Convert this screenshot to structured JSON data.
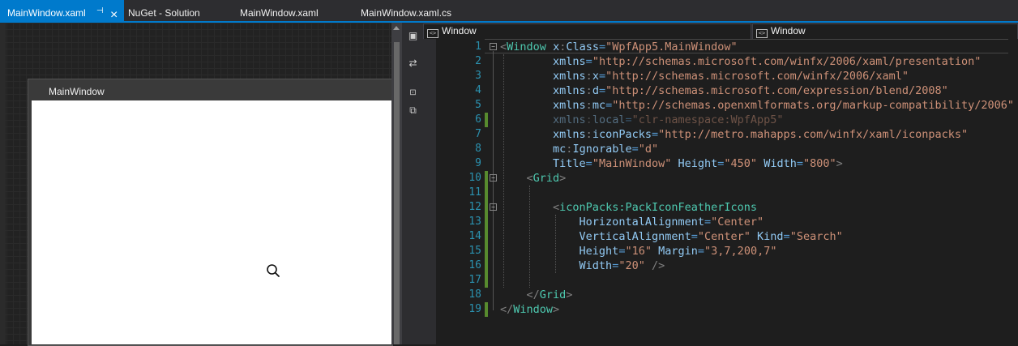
{
  "tabs": [
    {
      "label": "MainWindow.xaml",
      "active": true
    },
    {
      "label": "NuGet - Solution",
      "active": false
    },
    {
      "label": "MainWindow.xaml",
      "active": false
    },
    {
      "label": "MainWindow.xaml.cs",
      "active": false
    }
  ],
  "designer": {
    "window_title": "MainWindow",
    "icon": "search-icon"
  },
  "navbar": {
    "left": "Window",
    "right": "Window"
  },
  "editor": {
    "line_numbers": [
      "1",
      "2",
      "3",
      "4",
      "5",
      "6",
      "7",
      "8",
      "9",
      "10",
      "11",
      "12",
      "13",
      "14",
      "15",
      "16",
      "17",
      "18",
      "19"
    ],
    "lines": [
      [
        {
          "c": "t",
          "s": "<"
        },
        {
          "c": "el",
          "s": "Window"
        },
        {
          "c": "p",
          "s": " "
        },
        {
          "c": "a",
          "s": "x"
        },
        {
          "c": "t",
          "s": ":"
        },
        {
          "c": "a",
          "s": "Class"
        },
        {
          "c": "e",
          "s": "="
        },
        {
          "c": "v",
          "s": "\"WpfApp5.MainWindow\""
        }
      ],
      [
        {
          "c": "p",
          "s": "        "
        },
        {
          "c": "a",
          "s": "xmlns"
        },
        {
          "c": "e",
          "s": "="
        },
        {
          "c": "v",
          "s": "\"http://schemas.microsoft.com/winfx/2006/xaml/presentation\""
        }
      ],
      [
        {
          "c": "p",
          "s": "        "
        },
        {
          "c": "a",
          "s": "xmlns"
        },
        {
          "c": "t",
          "s": ":"
        },
        {
          "c": "a",
          "s": "x"
        },
        {
          "c": "e",
          "s": "="
        },
        {
          "c": "v",
          "s": "\"http://schemas.microsoft.com/winfx/2006/xaml\""
        }
      ],
      [
        {
          "c": "p",
          "s": "        "
        },
        {
          "c": "a",
          "s": "xmlns"
        },
        {
          "c": "t",
          "s": ":"
        },
        {
          "c": "a",
          "s": "d"
        },
        {
          "c": "e",
          "s": "="
        },
        {
          "c": "v",
          "s": "\"http://schemas.microsoft.com/expression/blend/2008\""
        }
      ],
      [
        {
          "c": "p",
          "s": "        "
        },
        {
          "c": "a",
          "s": "xmlns"
        },
        {
          "c": "t",
          "s": ":"
        },
        {
          "c": "a",
          "s": "mc"
        },
        {
          "c": "e",
          "s": "="
        },
        {
          "c": "v",
          "s": "\"http://schemas.openxmlformats.org/markup-compatibility/2006\""
        }
      ],
      [
        {
          "c": "p",
          "s": "        "
        },
        {
          "c": "a",
          "s": "xmlns"
        },
        {
          "c": "t",
          "s": ":"
        },
        {
          "c": "a",
          "s": "local"
        },
        {
          "c": "e",
          "s": "="
        },
        {
          "c": "v",
          "s": "\"clr-namespace:WpfApp5\""
        }
      ],
      [
        {
          "c": "p",
          "s": "        "
        },
        {
          "c": "a",
          "s": "xmlns"
        },
        {
          "c": "t",
          "s": ":"
        },
        {
          "c": "a",
          "s": "iconPacks"
        },
        {
          "c": "e",
          "s": "="
        },
        {
          "c": "v",
          "s": "\"http://metro.mahapps.com/winfx/xaml/iconpacks\""
        }
      ],
      [
        {
          "c": "p",
          "s": "        "
        },
        {
          "c": "a",
          "s": "mc"
        },
        {
          "c": "t",
          "s": ":"
        },
        {
          "c": "a",
          "s": "Ignorable"
        },
        {
          "c": "e",
          "s": "="
        },
        {
          "c": "v",
          "s": "\"d\""
        }
      ],
      [
        {
          "c": "p",
          "s": "        "
        },
        {
          "c": "a",
          "s": "Title"
        },
        {
          "c": "e",
          "s": "="
        },
        {
          "c": "v",
          "s": "\"MainWindow\""
        },
        {
          "c": "p",
          "s": " "
        },
        {
          "c": "a",
          "s": "Height"
        },
        {
          "c": "e",
          "s": "="
        },
        {
          "c": "v",
          "s": "\"450\""
        },
        {
          "c": "p",
          "s": " "
        },
        {
          "c": "a",
          "s": "Width"
        },
        {
          "c": "e",
          "s": "="
        },
        {
          "c": "v",
          "s": "\"800\""
        },
        {
          "c": "t",
          "s": ">"
        }
      ],
      [
        {
          "c": "p",
          "s": "    "
        },
        {
          "c": "t",
          "s": "<"
        },
        {
          "c": "el",
          "s": "Grid"
        },
        {
          "c": "t",
          "s": ">"
        }
      ],
      [
        {
          "c": "p",
          "s": ""
        }
      ],
      [
        {
          "c": "p",
          "s": "        "
        },
        {
          "c": "t",
          "s": "<"
        },
        {
          "c": "el",
          "s": "iconPacks:PackIconFeatherIcons"
        }
      ],
      [
        {
          "c": "p",
          "s": "            "
        },
        {
          "c": "a",
          "s": "HorizontalAlignment"
        },
        {
          "c": "e",
          "s": "="
        },
        {
          "c": "v",
          "s": "\"Center\""
        }
      ],
      [
        {
          "c": "p",
          "s": "            "
        },
        {
          "c": "a",
          "s": "VerticalAlignment"
        },
        {
          "c": "e",
          "s": "="
        },
        {
          "c": "v",
          "s": "\"Center\""
        },
        {
          "c": "p",
          "s": " "
        },
        {
          "c": "a",
          "s": "Kind"
        },
        {
          "c": "e",
          "s": "="
        },
        {
          "c": "v",
          "s": "\"Search\""
        }
      ],
      [
        {
          "c": "p",
          "s": "            "
        },
        {
          "c": "a",
          "s": "Height"
        },
        {
          "c": "e",
          "s": "="
        },
        {
          "c": "v",
          "s": "\"16\""
        },
        {
          "c": "p",
          "s": " "
        },
        {
          "c": "a",
          "s": "Margin"
        },
        {
          "c": "e",
          "s": "="
        },
        {
          "c": "v",
          "s": "\"3,7,200,7\""
        }
      ],
      [
        {
          "c": "p",
          "s": "            "
        },
        {
          "c": "a",
          "s": "Width"
        },
        {
          "c": "e",
          "s": "="
        },
        {
          "c": "v",
          "s": "\"20\""
        },
        {
          "c": "p",
          "s": " "
        },
        {
          "c": "t",
          "s": "/>"
        }
      ],
      [
        {
          "c": "p",
          "s": ""
        }
      ],
      [
        {
          "c": "p",
          "s": "    "
        },
        {
          "c": "t",
          "s": "</"
        },
        {
          "c": "el",
          "s": "Grid"
        },
        {
          "c": "t",
          "s": ">"
        }
      ],
      [
        {
          "c": "t",
          "s": "</"
        },
        {
          "c": "el",
          "s": "Window"
        },
        {
          "c": "t",
          "s": ">"
        }
      ]
    ],
    "dim_lines": [
      5
    ],
    "changed_lines": [
      5,
      9,
      10,
      11,
      12,
      13,
      14,
      15,
      16,
      18
    ],
    "fold_lines": [
      0,
      9,
      11
    ]
  },
  "colors": {
    "accent": "#007acc",
    "tag": "#4ec9b0",
    "attr": "#92caf4",
    "value": "#ce9178",
    "line_number": "#2b91af",
    "change": "#578a2e"
  }
}
